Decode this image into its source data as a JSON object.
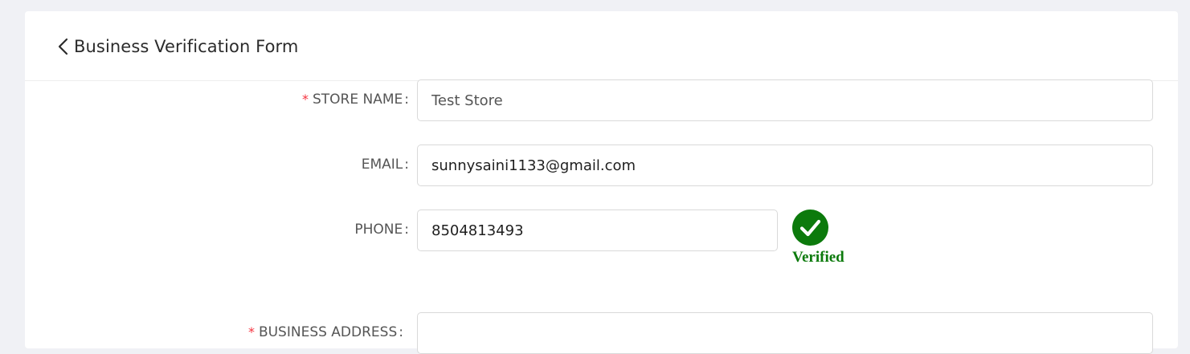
{
  "header": {
    "title": "Business Verification Form",
    "back_icon": "chevron-left-icon"
  },
  "form": {
    "store_name": {
      "required_mark": "*",
      "label": "STORE NAME",
      "colon": ":",
      "value": "Test Store"
    },
    "email": {
      "label": "EMAIL",
      "colon": ":",
      "value": "sunnysaini1133@gmail.com"
    },
    "phone": {
      "label": "PHONE",
      "colon": ":",
      "value": "8504813493",
      "status": {
        "icon": "check-circle-icon",
        "text": "Verified",
        "color": "#0c7a0c"
      }
    },
    "business_address": {
      "required_mark": "*",
      "label": "BUSINESS ADDRESS",
      "colon": ":"
    }
  },
  "colors": {
    "background": "#f0f1f5",
    "required": "#f5333f",
    "verified": "#0c7a0c"
  }
}
